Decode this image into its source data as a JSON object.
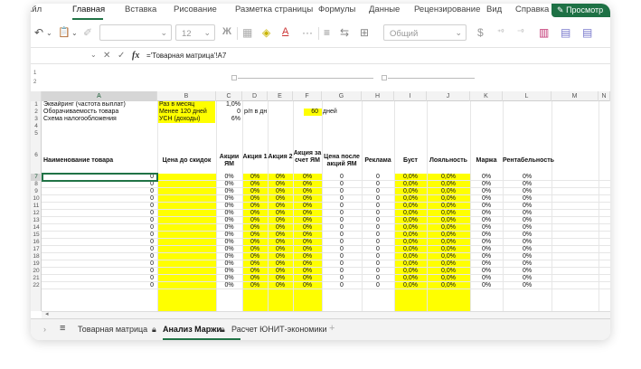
{
  "menu": {
    "items": [
      "айл",
      "Главная",
      "Вставка",
      "Рисование",
      "Разметка страницы",
      "Формулы",
      "Данные",
      "Рецензирование",
      "Вид",
      "Справка"
    ],
    "active_index": 1,
    "preview_label": "Просмотр"
  },
  "toolbar": {
    "font_size": "12",
    "bold_label": "Ж",
    "underline_label": "A",
    "more_label": "···",
    "number_format": "Общий",
    "currency_label": "$"
  },
  "formula_bar": {
    "name_box": "",
    "fx_label": "fx",
    "formula": "='Товарная матрица'!A7"
  },
  "outline_levels": [
    "1",
    "2"
  ],
  "columns": [
    "A",
    "B",
    "C",
    "D",
    "E",
    "F",
    "G",
    "H",
    "I",
    "J",
    "K",
    "L",
    "M",
    "N"
  ],
  "selected_column": "A",
  "rows": [
    "1",
    "2",
    "3",
    "4",
    "5",
    "6",
    "7",
    "8",
    "9",
    "10",
    "11",
    "12",
    "13",
    "14",
    "15",
    "16",
    "17",
    "18",
    "19",
    "20",
    "21",
    "22"
  ],
  "selected_row": "7",
  "params": {
    "r1_a": "Эквайринг (частота выплат)",
    "r1_b": "Раз в месяц",
    "r1_c": "1,0%",
    "r2_a": "Оборачиваемость товара",
    "r2_b": "Менее 120 дней",
    "r2_c": "0",
    "r2_d": "р/п в дн",
    "r2_e": "60",
    "r2_f": "дней",
    "r3_a": "Схема налогообложения",
    "r3_b": "УСН (доходы)",
    "r3_c": "6%"
  },
  "headers": {
    "a": "Наименование товара",
    "b": "Цена до скидок",
    "c": "Акции ЯМ",
    "d": "Акция 1",
    "e": "Акция 2",
    "f": "Акция за счет ЯМ",
    "g": "Цена после акций ЯМ",
    "h": "Реклама",
    "i": "Буст",
    "j": "Лояльность",
    "k": "Маржа",
    "l": "Рентабельность"
  },
  "data_row": {
    "a": "0",
    "c": "0%",
    "d": "0%",
    "e": "0%",
    "f": "0%",
    "g": "0",
    "h": "0",
    "i": "0,0%",
    "j": "0,0%",
    "k": "0%",
    "l": "0%"
  },
  "sheet_tabs": [
    {
      "label": "Товарная матрица",
      "locked": false
    },
    {
      "label": "Анализ Маржи",
      "locked": true
    },
    {
      "label": "Расчет ЮНИТ-экономики",
      "locked": true
    }
  ],
  "active_tab_index": 1,
  "colors": {
    "accent": "#217346",
    "highlight": "#ffff00",
    "preview_button": "#1e7145"
  }
}
